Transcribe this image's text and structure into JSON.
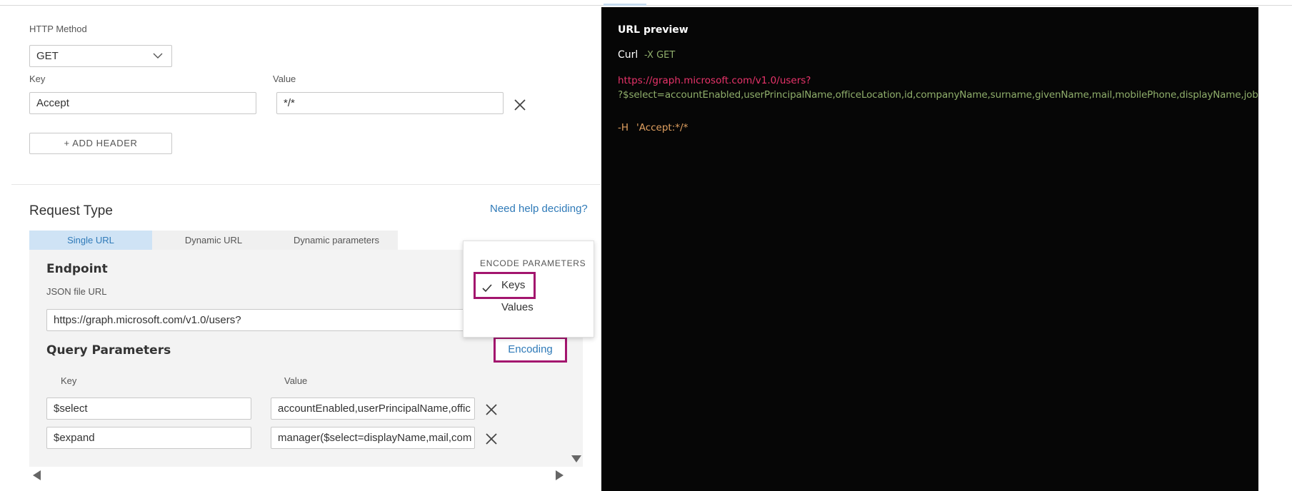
{
  "http": {
    "method_label": "HTTP Method",
    "method_value": "GET",
    "key_label": "Key",
    "value_label": "Value",
    "header_key": "Accept",
    "header_value": "*/*",
    "add_header": "+ ADD HEADER"
  },
  "request": {
    "title": "Request Type",
    "help_link": "Need help deciding?",
    "tabs": [
      {
        "label": "Single URL",
        "active": true
      },
      {
        "label": "Dynamic URL",
        "active": false
      },
      {
        "label": "Dynamic parameters",
        "active": false
      }
    ],
    "endpoint_title": "Endpoint",
    "json_url_label": "JSON file URL",
    "json_url_value": "https://graph.microsoft.com/v1.0/users?",
    "query_title": "Query Parameters",
    "encoding_button": "Encoding",
    "query_key_label": "Key",
    "query_value_label": "Value",
    "params": [
      {
        "key": "$select",
        "value": "accountEnabled,userPrincipalName,offic"
      },
      {
        "key": "$expand",
        "value": "manager($select=displayName,mail,com"
      }
    ]
  },
  "encode_popup": {
    "header": "ENCODE PARAMETERS",
    "options": [
      {
        "label": "Keys",
        "checked": true
      },
      {
        "label": "Values",
        "checked": false
      }
    ]
  },
  "preview": {
    "title": "URL preview",
    "curl": "Curl",
    "curl_method": "-X GET",
    "url_base": "https://graph.microsoft.com/v1.0/users?",
    "url_query": "?$select=accountEnabled,userPrincipalName,officeLocation,id,companyName,surname,givenName,mail,mobilePhone,displayName,jobTitle,depa",
    "header_flag": "-H",
    "header_value": "'Accept:*/*"
  },
  "colors": {
    "accent_link": "#2f7ab8",
    "highlight_box": "#a3156e",
    "preview_bg": "#060606",
    "preview_url": "#e8336a",
    "preview_query": "#8fae6b",
    "preview_header": "#e0a060"
  }
}
